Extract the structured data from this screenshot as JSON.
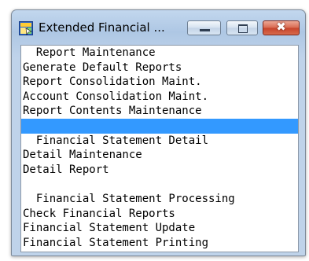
{
  "window": {
    "title": "Extended Financial ...",
    "icon": "app-window-icon",
    "controls": {
      "minimize": "minimize-icon",
      "maximize": "maximize-icon",
      "close": "✖"
    }
  },
  "menu": {
    "items": [
      "  Report Maintenance",
      "Generate Default Reports",
      "Report Consolidation Maint.",
      "Account Consolidation Maint.",
      "Report Contents Maintenance",
      "",
      "  Financial Statement Detail",
      "Detail Maintenance",
      "Detail Report",
      "",
      "  Financial Statement Processing",
      "Check Financial Reports",
      "Financial Statement Update",
      "Financial Statement Printing"
    ],
    "selected_index": 5
  },
  "colors": {
    "selection": "#3399ff"
  }
}
